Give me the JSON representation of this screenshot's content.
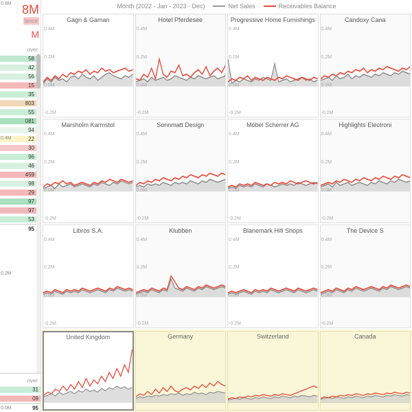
{
  "kpi": {
    "value": "8M",
    "label": "lance",
    "sub_value": "M"
  },
  "subheading1": "over",
  "subheading2": "over",
  "table1": {
    "rows": [
      {
        "v": "58",
        "c": "#bfe8d0"
      },
      {
        "v": "42",
        "c": "#d8f0e0"
      },
      {
        "v": "56",
        "c": "#d8f0e0"
      },
      {
        "v": "15",
        "c": "#f5b8b8"
      },
      {
        "v": "35",
        "c": "#c8eed8"
      },
      {
        "v": "803",
        "c": "#f0d8b8"
      },
      {
        "v": "55",
        "c": "#c8eed8"
      },
      {
        "v": "081",
        "c": "#a8e0c0"
      },
      {
        "v": "94",
        "c": "#e8f4ec"
      },
      {
        "v": "22",
        "c": "#fdf5c8"
      },
      {
        "v": "30",
        "c": "#f5c8c8"
      },
      {
        "v": "96",
        "c": "#c8eed8"
      },
      {
        "v": "46",
        "c": "#d8f0e0"
      },
      {
        "v": "459",
        "c": "#f5b8b8"
      },
      {
        "v": "98",
        "c": "#d8f0e0"
      },
      {
        "v": "29",
        "c": "#f5b8b8"
      },
      {
        "v": "97",
        "c": "#a8e0c0"
      },
      {
        "v": "97",
        "c": "#f0b8b8"
      },
      {
        "v": "53",
        "c": "#c8eed8"
      }
    ],
    "total": "95"
  },
  "table2": {
    "rows": [
      {
        "v": "31",
        "c": "#c8eed8"
      },
      {
        "v": "09",
        "c": "#f5b8b8"
      }
    ],
    "total": "95"
  },
  "legend": {
    "period": "Month (2022 - Jan - 2023 - Dec)",
    "s1": "Net Sales",
    "s2": "Receivables Balance",
    "c1": "#999",
    "c2": "#e74c3c"
  },
  "chart_data": {
    "type": "line",
    "ylim": [
      -0.2,
      0.4
    ],
    "yticks": [
      "0.4M",
      "0.2M",
      "0.0M",
      "-0.2M"
    ],
    "yticks_country": [
      "0.6M",
      "0.4M",
      "0.2M",
      "0.0M"
    ],
    "panels": [
      {
        "title": "Gagn & Gaman",
        "alt": false,
        "net": [
          0.02,
          0.05,
          0.03,
          0.06,
          0.04,
          0.05,
          0.03,
          0.06,
          0.07,
          0.05,
          0.08,
          0.06,
          0.05,
          0.07,
          0.04,
          0.06,
          0.08,
          0.09,
          0.07,
          0.06,
          0.05,
          0.07,
          0.06,
          0.08
        ],
        "recv": [
          0.03,
          0.06,
          0.04,
          0.07,
          0.05,
          0.08,
          0.06,
          0.09,
          0.08,
          0.1,
          0.09,
          0.11,
          0.08,
          0.1,
          0.09,
          0.12,
          0.1,
          0.11,
          0.09,
          0.1,
          0.11,
          0.12,
          0.1,
          0.11
        ]
      },
      {
        "title": "Hotel Pferdesee",
        "alt": true,
        "net": [
          0.03,
          0.04,
          0.05,
          0.03,
          0.06,
          0.04,
          0.05,
          0.06,
          0.04,
          0.05,
          0.07,
          0.06,
          0.05,
          0.04,
          0.06,
          0.05,
          0.07,
          0.06,
          0.05,
          0.06,
          0.07,
          0.05,
          0.06,
          0.07
        ],
        "recv": [
          0.05,
          0.04,
          0.08,
          0.06,
          0.12,
          0.05,
          0.18,
          0.08,
          0.06,
          0.1,
          0.09,
          0.14,
          0.07,
          0.08,
          0.06,
          0.09,
          0.11,
          0.08,
          0.13,
          0.07,
          0.1,
          0.12,
          0.09,
          0.14
        ]
      },
      {
        "title": "Progressive Home Furnishings",
        "alt": false,
        "net": [
          0.18,
          0.02,
          0.04,
          0.03,
          0.05,
          0.04,
          0.03,
          0.05,
          0.04,
          0.06,
          0.05,
          0.04,
          0.15,
          0.03,
          0.04,
          0.05,
          0.03,
          0.04,
          0.05,
          0.06,
          0.04,
          0.05,
          0.03,
          0.04
        ],
        "recv": [
          0.03,
          0.05,
          0.04,
          0.06,
          0.05,
          0.07,
          0.04,
          0.06,
          0.05,
          0.04,
          0.06,
          0.05,
          0.04,
          0.06,
          0.05,
          0.07,
          0.06,
          0.05,
          0.04,
          0.06,
          0.05,
          0.04,
          0.06,
          0.05
        ]
      },
      {
        "title": "Candoxy Cana",
        "alt": true,
        "net": [
          0.04,
          0.05,
          0.06,
          0.04,
          0.07,
          0.05,
          0.06,
          0.08,
          0.05,
          0.07,
          0.06,
          0.08,
          0.07,
          0.06,
          0.08,
          0.07,
          0.09,
          0.08,
          0.07,
          0.09,
          0.08,
          0.1,
          0.09,
          0.08
        ],
        "recv": [
          0.05,
          0.07,
          0.06,
          0.08,
          0.07,
          0.09,
          0.08,
          0.1,
          0.09,
          0.11,
          0.1,
          0.12,
          0.09,
          0.11,
          0.1,
          0.12,
          0.11,
          0.13,
          0.12,
          0.11,
          0.1,
          0.12,
          0.11,
          0.13
        ]
      },
      {
        "title": "Marsholm Karmstol",
        "alt": false,
        "net": [
          0.02,
          0.03,
          0.04,
          0.02,
          0.05,
          0.03,
          0.04,
          0.05,
          0.03,
          0.04,
          0.05,
          0.04,
          0.03,
          0.05,
          0.04,
          0.06,
          0.05,
          0.04,
          0.06,
          0.05,
          0.07,
          0.06,
          0.05,
          0.06
        ],
        "recv": [
          0.03,
          0.05,
          0.04,
          0.06,
          0.05,
          0.07,
          0.05,
          0.06,
          0.04,
          0.05,
          0.06,
          0.05,
          0.04,
          0.06,
          0.05,
          0.07,
          0.06,
          0.08,
          0.07,
          0.06,
          0.08,
          0.07,
          0.06,
          0.07
        ]
      },
      {
        "title": "Sonnmatt Design",
        "alt": true,
        "net": [
          0.03,
          0.04,
          0.03,
          0.05,
          0.04,
          0.05,
          0.04,
          0.06,
          0.05,
          0.04,
          0.06,
          0.05,
          0.06,
          0.05,
          0.07,
          0.06,
          0.05,
          0.07,
          0.06,
          0.08,
          0.07,
          0.06,
          0.07,
          0.08
        ],
        "recv": [
          0.04,
          0.06,
          0.05,
          0.07,
          0.06,
          0.08,
          0.07,
          0.09,
          0.08,
          0.07,
          0.09,
          0.08,
          0.1,
          0.09,
          0.11,
          0.1,
          0.09,
          0.11,
          0.1,
          0.12,
          0.11,
          0.1,
          0.12,
          0.11
        ]
      },
      {
        "title": "Möbel Scherrer AG",
        "alt": false,
        "net": [
          0.02,
          0.03,
          0.02,
          0.04,
          0.03,
          0.04,
          0.03,
          0.05,
          0.04,
          0.03,
          0.05,
          0.04,
          0.03,
          0.04,
          0.05,
          0.04,
          0.05,
          0.04,
          0.06,
          0.05,
          0.04,
          0.05,
          0.06,
          0.05
        ],
        "recv": [
          0.03,
          0.04,
          0.03,
          0.05,
          0.04,
          0.05,
          0.04,
          0.06,
          0.05,
          0.04,
          0.05,
          0.04,
          0.06,
          0.05,
          0.06,
          0.05,
          0.07,
          0.06,
          0.05,
          0.06,
          0.07,
          0.06,
          0.05,
          0.06
        ]
      },
      {
        "title": "Highlights Electroni",
        "alt": true,
        "net": [
          0.03,
          0.04,
          0.05,
          0.03,
          0.06,
          0.04,
          0.05,
          0.06,
          0.04,
          0.05,
          0.06,
          0.05,
          0.04,
          0.06,
          0.05,
          0.07,
          0.06,
          0.05,
          0.07,
          0.06,
          0.08,
          0.07,
          0.06,
          0.07
        ],
        "recv": [
          0.04,
          0.05,
          0.06,
          0.05,
          0.07,
          0.06,
          0.08,
          0.07,
          0.06,
          0.08,
          0.07,
          0.09,
          0.08,
          0.07,
          0.09,
          0.08,
          0.1,
          0.09,
          0.08,
          0.1,
          0.09,
          0.11,
          0.1,
          0.09
        ]
      },
      {
        "title": "Libros S.A.",
        "alt": false,
        "net": [
          0.02,
          0.03,
          0.02,
          0.04,
          0.03,
          0.02,
          0.04,
          0.03,
          0.04,
          0.03,
          0.05,
          0.04,
          0.03,
          0.04,
          0.05,
          0.04,
          0.03,
          0.05,
          0.04,
          0.06,
          0.05,
          0.04,
          0.05,
          0.04
        ],
        "recv": [
          0.03,
          0.04,
          0.03,
          0.05,
          0.04,
          0.03,
          0.05,
          0.04,
          0.05,
          0.04,
          0.06,
          0.05,
          0.04,
          0.05,
          0.06,
          0.05,
          0.04,
          0.06,
          0.05,
          0.07,
          0.06,
          0.05,
          0.06,
          0.05
        ]
      },
      {
        "title": "Klubben",
        "alt": true,
        "net": [
          0.02,
          0.03,
          0.04,
          0.03,
          0.05,
          0.04,
          0.03,
          0.05,
          0.04,
          0.12,
          0.06,
          0.05,
          0.04,
          0.06,
          0.05,
          0.04,
          0.06,
          0.05,
          0.07,
          0.06,
          0.05,
          0.06,
          0.07,
          0.06
        ],
        "recv": [
          0.03,
          0.04,
          0.05,
          0.04,
          0.06,
          0.05,
          0.04,
          0.06,
          0.05,
          0.14,
          0.1,
          0.06,
          0.05,
          0.07,
          0.06,
          0.05,
          0.07,
          0.06,
          0.08,
          0.07,
          0.06,
          0.07,
          0.08,
          0.07
        ]
      },
      {
        "title": "Blanemark Hifi Shops",
        "alt": false,
        "net": [
          0.02,
          0.03,
          0.02,
          0.03,
          0.04,
          0.03,
          0.02,
          0.04,
          0.03,
          0.04,
          0.03,
          0.05,
          0.04,
          0.03,
          0.04,
          0.05,
          0.04,
          0.03,
          0.05,
          0.04,
          0.03,
          0.04,
          0.05,
          0.04
        ],
        "recv": [
          0.03,
          0.04,
          0.03,
          0.04,
          0.05,
          0.04,
          0.03,
          0.05,
          0.04,
          0.05,
          0.04,
          0.06,
          0.05,
          0.04,
          0.05,
          0.06,
          0.05,
          0.04,
          0.06,
          0.05,
          0.04,
          0.05,
          0.06,
          0.05
        ]
      },
      {
        "title": "The Device S",
        "alt": true,
        "net": [
          0.02,
          0.03,
          0.04,
          0.03,
          0.05,
          0.04,
          0.03,
          0.05,
          0.04,
          0.06,
          0.05,
          0.04,
          0.05,
          0.06,
          0.05,
          0.04,
          0.06,
          0.05,
          0.07,
          0.06,
          0.05,
          0.06,
          0.07,
          0.06
        ],
        "recv": [
          0.03,
          0.04,
          0.05,
          0.04,
          0.06,
          0.05,
          0.04,
          0.06,
          0.05,
          0.07,
          0.06,
          0.05,
          0.06,
          0.07,
          0.06,
          0.05,
          0.07,
          0.06,
          0.08,
          0.07,
          0.06,
          0.07,
          0.08,
          0.07
        ]
      }
    ],
    "countries": [
      {
        "title": "United Kingdom",
        "hl": true,
        "net": [
          0.08,
          0.1,
          0.12,
          0.09,
          0.14,
          0.11,
          0.13,
          0.15,
          0.12,
          0.16,
          0.14,
          0.18,
          0.15,
          0.17,
          0.14,
          0.19,
          0.16,
          0.2,
          0.18,
          0.22,
          0.19,
          0.21,
          0.18,
          0.2
        ],
        "recv": [
          0.1,
          0.14,
          0.12,
          0.18,
          0.15,
          0.22,
          0.16,
          0.24,
          0.18,
          0.28,
          0.2,
          0.32,
          0.22,
          0.3,
          0.25,
          0.35,
          0.28,
          0.4,
          0.32,
          0.45,
          0.35,
          0.5,
          0.4,
          0.7
        ]
      },
      {
        "title": "Germany",
        "hl": false,
        "net": [
          0.06,
          0.08,
          0.07,
          0.09,
          0.08,
          0.1,
          0.09,
          0.11,
          0.1,
          0.12,
          0.11,
          0.13,
          0.1,
          0.12,
          0.11,
          0.14,
          0.12,
          0.13,
          0.11,
          0.14,
          0.13,
          0.15,
          0.14,
          0.13
        ],
        "recv": [
          0.08,
          0.12,
          0.1,
          0.15,
          0.11,
          0.18,
          0.13,
          0.2,
          0.15,
          0.22,
          0.16,
          0.14,
          0.18,
          0.2,
          0.17,
          0.22,
          0.19,
          0.24,
          0.2,
          0.26,
          0.22,
          0.28,
          0.24,
          0.22
        ]
      },
      {
        "title": "Switzerland",
        "hl": false,
        "net": [
          0.04,
          0.05,
          0.06,
          0.05,
          0.07,
          0.06,
          0.05,
          0.07,
          0.06,
          0.08,
          0.07,
          0.06,
          0.08,
          0.07,
          0.09,
          0.08,
          0.07,
          0.09,
          0.08,
          0.1,
          0.09,
          0.08,
          0.1,
          0.09
        ],
        "recv": [
          0.05,
          0.07,
          0.06,
          0.08,
          0.07,
          0.09,
          0.08,
          0.1,
          0.09,
          0.11,
          0.1,
          0.09,
          0.11,
          0.1,
          0.12,
          0.11,
          0.1,
          0.12,
          0.14,
          0.16,
          0.18,
          0.2,
          0.22,
          0.2
        ]
      },
      {
        "title": "Canada",
        "hl": false,
        "net": [
          0.05,
          0.06,
          0.07,
          0.06,
          0.08,
          0.07,
          0.06,
          0.08,
          0.07,
          0.09,
          0.08,
          0.07,
          0.09,
          0.08,
          0.1,
          0.09,
          0.08,
          0.1,
          0.09,
          0.11,
          0.1,
          0.09,
          0.11,
          0.1
        ],
        "recv": [
          0.06,
          0.08,
          0.07,
          0.09,
          0.08,
          0.1,
          0.09,
          0.11,
          0.1,
          0.12,
          0.11,
          0.1,
          0.12,
          0.11,
          0.13,
          0.12,
          0.11,
          0.13,
          0.12,
          0.14,
          0.13,
          0.12,
          0.14,
          0.13
        ]
      }
    ]
  }
}
